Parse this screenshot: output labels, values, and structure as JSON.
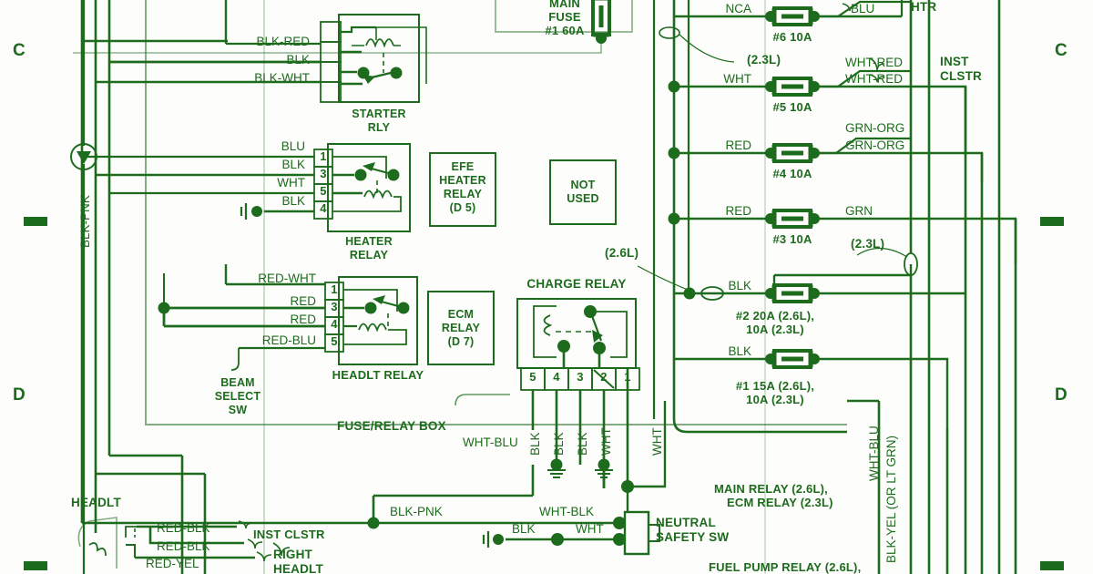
{
  "meta": {
    "title": "Fuse/Relay Box Wiring Diagram",
    "ink": "#1d6b1d",
    "paper": "#fdfdfb"
  },
  "grid_markers": [
    {
      "label": "C",
      "side": "left"
    },
    {
      "label": "C",
      "side": "right"
    },
    {
      "label": "D",
      "side": "left"
    },
    {
      "label": "D",
      "side": "right"
    }
  ],
  "relays": [
    {
      "name": "STARTER\nRLY",
      "name_line1": "STARTER",
      "name_line2": "RLY",
      "wires": [
        "BLK-RED",
        "BLK",
        "BLK-WHT"
      ],
      "pins": []
    },
    {
      "name_line1": "HEATER",
      "name_line2": "RELAY",
      "wires": [
        "BLU",
        "BLK",
        "WHT",
        "BLK"
      ],
      "pins": [
        "1",
        "3",
        "5",
        "4"
      ]
    },
    {
      "name_line1": "HEADLT RELAY",
      "name_line2": "",
      "wires": [
        "RED-WHT",
        "RED",
        "RED",
        "RED-BLU"
      ],
      "pins": [
        "1",
        "3",
        "4",
        "5"
      ]
    }
  ],
  "empty_boxes": [
    {
      "lines": [
        "EFE",
        "HEATER",
        "RELAY",
        "(D 5)"
      ]
    },
    {
      "lines": [
        "NOT",
        "USED"
      ]
    },
    {
      "lines": [
        "ECM",
        "RELAY",
        "(D 7)"
      ]
    }
  ],
  "charge_relay": {
    "title": "CHARGE RELAY",
    "pins": [
      "5",
      "4",
      "3",
      "2",
      "1"
    ],
    "pin_wires": [
      "BLK",
      "BLK",
      "BLK",
      "WHT"
    ]
  },
  "main_fuse": {
    "line1": "MAIN",
    "line2": "FUSE",
    "line3": "#1 60A"
  },
  "fuses": [
    {
      "id": "#6 10A",
      "in": "NCA",
      "out": "BLU",
      "out2": "",
      "dest": "HTR"
    },
    {
      "id": "#5 10A",
      "in": "WHT",
      "out": "WHT-RED",
      "out2": "WHT-RED",
      "dest_line1": "INST",
      "dest_line2": "CLSTR"
    },
    {
      "id": "#4 10A",
      "in": "RED",
      "out": "GRN-ORG",
      "out2": "GRN-ORG",
      "dest": ""
    },
    {
      "id": "#3 10A",
      "in": "RED",
      "out": "GRN",
      "out2": "",
      "dest": ""
    },
    {
      "id": "#2 20A (2.6L),",
      "id2": "10A (2.3L)",
      "in": "BLK",
      "out": "",
      "out2": "",
      "dest": ""
    },
    {
      "id": "#1 15A (2.6L),",
      "id2": "10A (2.3L)",
      "in": "BLK",
      "out": "",
      "out2": "",
      "dest": ""
    }
  ],
  "annotations": [
    {
      "text": "(2.3L)"
    },
    {
      "text": "(2.6L)"
    },
    {
      "text": "(2.3L)"
    },
    {
      "text": "(2.3L)"
    }
  ],
  "labels": {
    "blk_pnk_vertical": "BLK-PNK",
    "beam_select_sw": [
      "BEAM",
      "SELECT",
      "SW"
    ],
    "fuse_relay_box": "FUSE/RELAY BOX",
    "wht_blu": "WHT-BLU",
    "headlt": "HEADLT",
    "neutral_safety_sw": [
      "NEUTRAL",
      "SAFETY SW"
    ],
    "main_ecm_relay": [
      "MAIN RELAY (2.6L),",
      "ECM RELAY (2.3L)"
    ],
    "fuel_pump_relay": "FUEL PUMP RELAY (2.6L),",
    "wht_blu_vertical": "WHT-BLU",
    "blk_yel_vertical": "BLK-YEL (OR LT GRN)",
    "wht_vertical": "WHT",
    "blk_pnk_bottom": "BLK-PNK",
    "wht_blk_bottom": "WHT-BLK",
    "blk_bottom": "BLK",
    "wht_bottom": "WHT",
    "inst_clstr_bottom": "INST CLSTR",
    "right_headlt": [
      "RIGHT",
      "HEADLT"
    ],
    "bottom_wires": [
      "RED-BLK",
      "RED-BLK",
      "RED-YEL"
    ]
  }
}
